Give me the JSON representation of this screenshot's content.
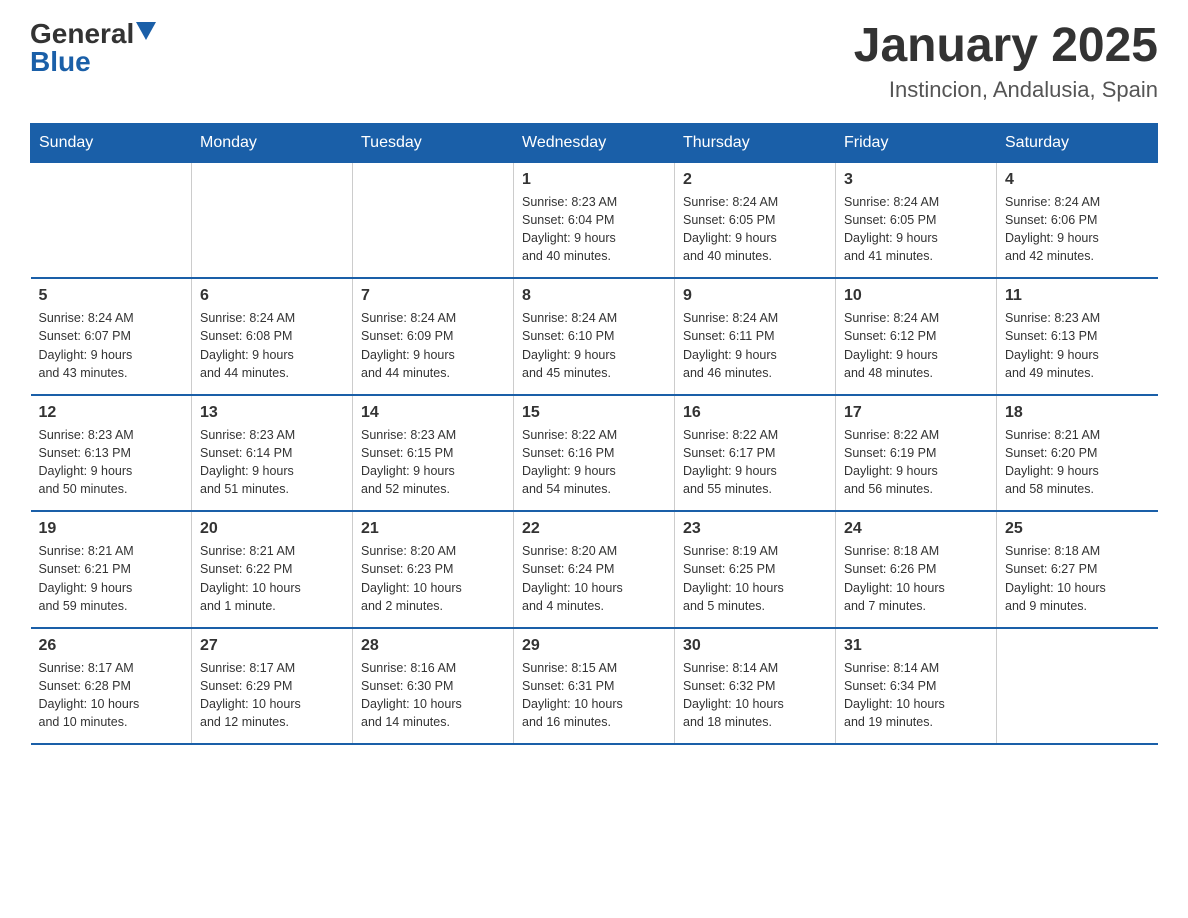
{
  "logo": {
    "general": "General",
    "blue": "Blue"
  },
  "title": "January 2025",
  "location": "Instincion, Andalusia, Spain",
  "days_header": [
    "Sunday",
    "Monday",
    "Tuesday",
    "Wednesday",
    "Thursday",
    "Friday",
    "Saturday"
  ],
  "weeks": [
    [
      {
        "day": "",
        "info": ""
      },
      {
        "day": "",
        "info": ""
      },
      {
        "day": "",
        "info": ""
      },
      {
        "day": "1",
        "info": "Sunrise: 8:23 AM\nSunset: 6:04 PM\nDaylight: 9 hours\nand 40 minutes."
      },
      {
        "day": "2",
        "info": "Sunrise: 8:24 AM\nSunset: 6:05 PM\nDaylight: 9 hours\nand 40 minutes."
      },
      {
        "day": "3",
        "info": "Sunrise: 8:24 AM\nSunset: 6:05 PM\nDaylight: 9 hours\nand 41 minutes."
      },
      {
        "day": "4",
        "info": "Sunrise: 8:24 AM\nSunset: 6:06 PM\nDaylight: 9 hours\nand 42 minutes."
      }
    ],
    [
      {
        "day": "5",
        "info": "Sunrise: 8:24 AM\nSunset: 6:07 PM\nDaylight: 9 hours\nand 43 minutes."
      },
      {
        "day": "6",
        "info": "Sunrise: 8:24 AM\nSunset: 6:08 PM\nDaylight: 9 hours\nand 44 minutes."
      },
      {
        "day": "7",
        "info": "Sunrise: 8:24 AM\nSunset: 6:09 PM\nDaylight: 9 hours\nand 44 minutes."
      },
      {
        "day": "8",
        "info": "Sunrise: 8:24 AM\nSunset: 6:10 PM\nDaylight: 9 hours\nand 45 minutes."
      },
      {
        "day": "9",
        "info": "Sunrise: 8:24 AM\nSunset: 6:11 PM\nDaylight: 9 hours\nand 46 minutes."
      },
      {
        "day": "10",
        "info": "Sunrise: 8:24 AM\nSunset: 6:12 PM\nDaylight: 9 hours\nand 48 minutes."
      },
      {
        "day": "11",
        "info": "Sunrise: 8:23 AM\nSunset: 6:13 PM\nDaylight: 9 hours\nand 49 minutes."
      }
    ],
    [
      {
        "day": "12",
        "info": "Sunrise: 8:23 AM\nSunset: 6:13 PM\nDaylight: 9 hours\nand 50 minutes."
      },
      {
        "day": "13",
        "info": "Sunrise: 8:23 AM\nSunset: 6:14 PM\nDaylight: 9 hours\nand 51 minutes."
      },
      {
        "day": "14",
        "info": "Sunrise: 8:23 AM\nSunset: 6:15 PM\nDaylight: 9 hours\nand 52 minutes."
      },
      {
        "day": "15",
        "info": "Sunrise: 8:22 AM\nSunset: 6:16 PM\nDaylight: 9 hours\nand 54 minutes."
      },
      {
        "day": "16",
        "info": "Sunrise: 8:22 AM\nSunset: 6:17 PM\nDaylight: 9 hours\nand 55 minutes."
      },
      {
        "day": "17",
        "info": "Sunrise: 8:22 AM\nSunset: 6:19 PM\nDaylight: 9 hours\nand 56 minutes."
      },
      {
        "day": "18",
        "info": "Sunrise: 8:21 AM\nSunset: 6:20 PM\nDaylight: 9 hours\nand 58 minutes."
      }
    ],
    [
      {
        "day": "19",
        "info": "Sunrise: 8:21 AM\nSunset: 6:21 PM\nDaylight: 9 hours\nand 59 minutes."
      },
      {
        "day": "20",
        "info": "Sunrise: 8:21 AM\nSunset: 6:22 PM\nDaylight: 10 hours\nand 1 minute."
      },
      {
        "day": "21",
        "info": "Sunrise: 8:20 AM\nSunset: 6:23 PM\nDaylight: 10 hours\nand 2 minutes."
      },
      {
        "day": "22",
        "info": "Sunrise: 8:20 AM\nSunset: 6:24 PM\nDaylight: 10 hours\nand 4 minutes."
      },
      {
        "day": "23",
        "info": "Sunrise: 8:19 AM\nSunset: 6:25 PM\nDaylight: 10 hours\nand 5 minutes."
      },
      {
        "day": "24",
        "info": "Sunrise: 8:18 AM\nSunset: 6:26 PM\nDaylight: 10 hours\nand 7 minutes."
      },
      {
        "day": "25",
        "info": "Sunrise: 8:18 AM\nSunset: 6:27 PM\nDaylight: 10 hours\nand 9 minutes."
      }
    ],
    [
      {
        "day": "26",
        "info": "Sunrise: 8:17 AM\nSunset: 6:28 PM\nDaylight: 10 hours\nand 10 minutes."
      },
      {
        "day": "27",
        "info": "Sunrise: 8:17 AM\nSunset: 6:29 PM\nDaylight: 10 hours\nand 12 minutes."
      },
      {
        "day": "28",
        "info": "Sunrise: 8:16 AM\nSunset: 6:30 PM\nDaylight: 10 hours\nand 14 minutes."
      },
      {
        "day": "29",
        "info": "Sunrise: 8:15 AM\nSunset: 6:31 PM\nDaylight: 10 hours\nand 16 minutes."
      },
      {
        "day": "30",
        "info": "Sunrise: 8:14 AM\nSunset: 6:32 PM\nDaylight: 10 hours\nand 18 minutes."
      },
      {
        "day": "31",
        "info": "Sunrise: 8:14 AM\nSunset: 6:34 PM\nDaylight: 10 hours\nand 19 minutes."
      },
      {
        "day": "",
        "info": ""
      }
    ]
  ]
}
